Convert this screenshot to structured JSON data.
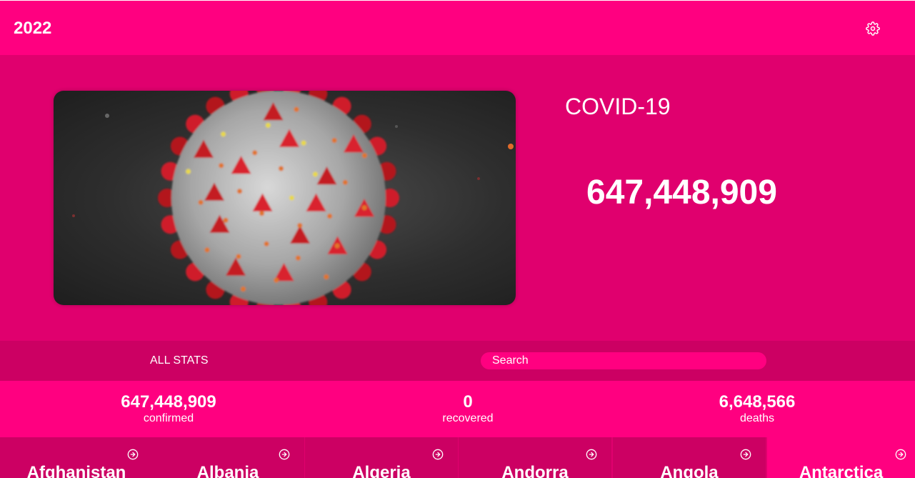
{
  "header": {
    "brand": "2022",
    "settings_icon": "gear-icon"
  },
  "hero": {
    "image": "coronavirus-illustration",
    "title": "COVID-19",
    "total": "647,448,909"
  },
  "filter": {
    "all_stats_label": "ALL STATS",
    "search_placeholder": "Search"
  },
  "stats": [
    {
      "value": "647,448,909",
      "label": "confirmed"
    },
    {
      "value": "0",
      "label": "recovered"
    },
    {
      "value": "6,648,566",
      "label": "deaths"
    }
  ],
  "countries": [
    {
      "name": "Afghanistan",
      "icon": "arrow-right-circle-icon"
    },
    {
      "name": "Albania",
      "icon": "arrow-right-circle-icon"
    },
    {
      "name": "Algeria",
      "icon": "arrow-right-circle-icon"
    },
    {
      "name": "Andorra",
      "icon": "arrow-right-circle-icon"
    },
    {
      "name": "Angola",
      "icon": "arrow-right-circle-icon"
    },
    {
      "name": "Antarctica",
      "icon": "arrow-right-circle-icon"
    }
  ],
  "colors": {
    "primary": "#ff0080",
    "hero_bg": "#e0006e",
    "dark": "#cc0063",
    "text": "#ffffff"
  }
}
